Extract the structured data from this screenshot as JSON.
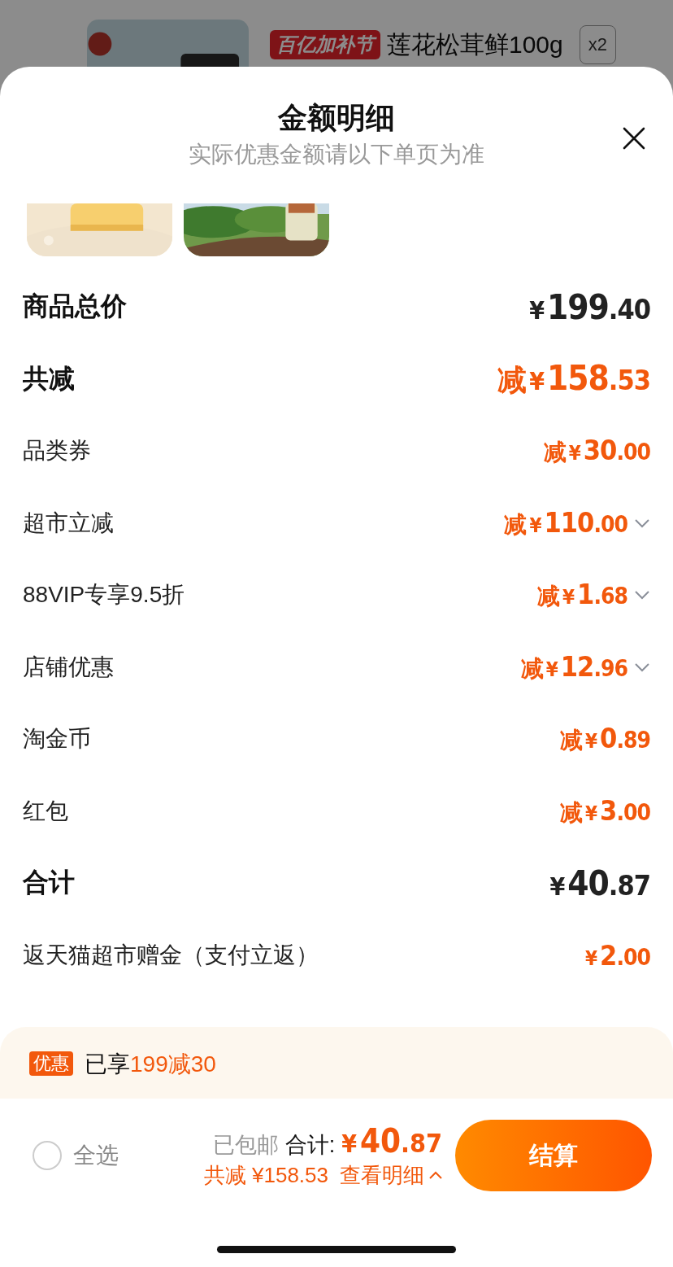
{
  "background_item": {
    "badge": "百亿加补节",
    "title": "莲花松茸鲜100g",
    "quantity": "x2"
  },
  "sheet": {
    "title": "金额明细",
    "subtitle": "实际优惠金额请以下单页为准",
    "rows": [
      {
        "kind": "major",
        "label": "商品总价",
        "prefix": "",
        "currency": "¥",
        "integer": "199",
        "decimal": ".40",
        "color": "#222222",
        "expandable": false
      },
      {
        "kind": "major",
        "label": "共减",
        "prefix": "减",
        "currency": "¥",
        "integer": "158",
        "decimal": ".53",
        "color": "#f2580c",
        "expandable": false
      },
      {
        "kind": "minor",
        "label": "品类券",
        "prefix": "减",
        "currency": "¥",
        "integer": "30",
        "decimal": ".00",
        "color": "#f2580c",
        "expandable": false
      },
      {
        "kind": "minor",
        "label": "超市立减",
        "prefix": "减",
        "currency": "¥",
        "integer": "110",
        "decimal": ".00",
        "color": "#f2580c",
        "expandable": true
      },
      {
        "kind": "minor",
        "label": "88VIP专享9.5折",
        "prefix": "减",
        "currency": "¥",
        "integer": "1",
        "decimal": ".68",
        "color": "#f2580c",
        "expandable": true
      },
      {
        "kind": "minor",
        "label": "店铺优惠",
        "prefix": "减",
        "currency": "¥",
        "integer": "12",
        "decimal": ".96",
        "color": "#f2580c",
        "expandable": true
      },
      {
        "kind": "minor",
        "label": "淘金币",
        "prefix": "减",
        "currency": "¥",
        "integer": "0",
        "decimal": ".89",
        "color": "#f2580c",
        "expandable": false
      },
      {
        "kind": "minor",
        "label": "红包",
        "prefix": "减",
        "currency": "¥",
        "integer": "3",
        "decimal": ".00",
        "color": "#f2580c",
        "expandable": false
      },
      {
        "kind": "major",
        "label": "合计",
        "prefix": "",
        "currency": "¥",
        "integer": "40",
        "decimal": ".87",
        "color": "#222222",
        "expandable": false
      },
      {
        "kind": "minor",
        "label": "返天猫超市赠金（支付立返）",
        "prefix": "",
        "currency": "¥",
        "integer": "2",
        "decimal": ".00",
        "color": "#f2580c",
        "expandable": false
      }
    ]
  },
  "promo": {
    "tag": "优惠",
    "text": "已享",
    "highlight": "199减30"
  },
  "footer": {
    "select_all": {
      "label": "全选",
      "checked": false
    },
    "shipping": "已包邮",
    "total_label": "合计:",
    "total_currency": "¥",
    "total_integer": "40",
    "total_decimal": ".87",
    "saved": "共减 ¥158.53",
    "details_link": "查看明细",
    "expanded": true,
    "checkout_button": "结算"
  }
}
